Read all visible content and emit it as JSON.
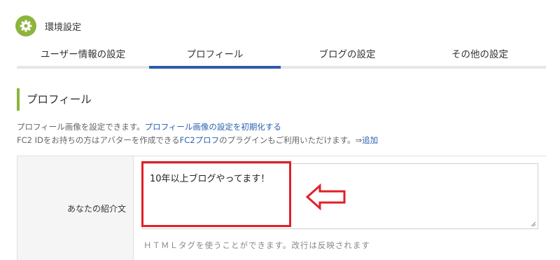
{
  "header": {
    "title": "環境設定",
    "icon": "gear-icon",
    "accent_color": "#8db43e"
  },
  "tabs": [
    {
      "label": "ユーザー情報の設定",
      "active": false
    },
    {
      "label": "プロフィール",
      "active": true
    },
    {
      "label": "ブログの設定",
      "active": false
    },
    {
      "label": "その他の設定",
      "active": false
    }
  ],
  "section": {
    "title": "プロフィール",
    "desc_line1": {
      "text": "プロフィール画像を設定できます。",
      "link": "プロフィール画像の設定を初期化する"
    },
    "desc_line2": {
      "text_before": "FC2 IDをお持ちの方はアバターを作成できる",
      "link_fc2": "FC2プロフ",
      "text_after": "のプラグインもご利用いただけます。⇒",
      "link_add": "追加"
    }
  },
  "form": {
    "field_label": "あなたの紹介文",
    "textarea_value": "10年以上ブログやってます！",
    "hint": "ＨＴＭＬタグを使うことができます。改行は反映されます"
  },
  "annotation": {
    "highlight_color": "#e0202a",
    "arrow_direction": "left"
  },
  "colors": {
    "tab_active": "#2e5aab",
    "link": "#2c62b0"
  }
}
